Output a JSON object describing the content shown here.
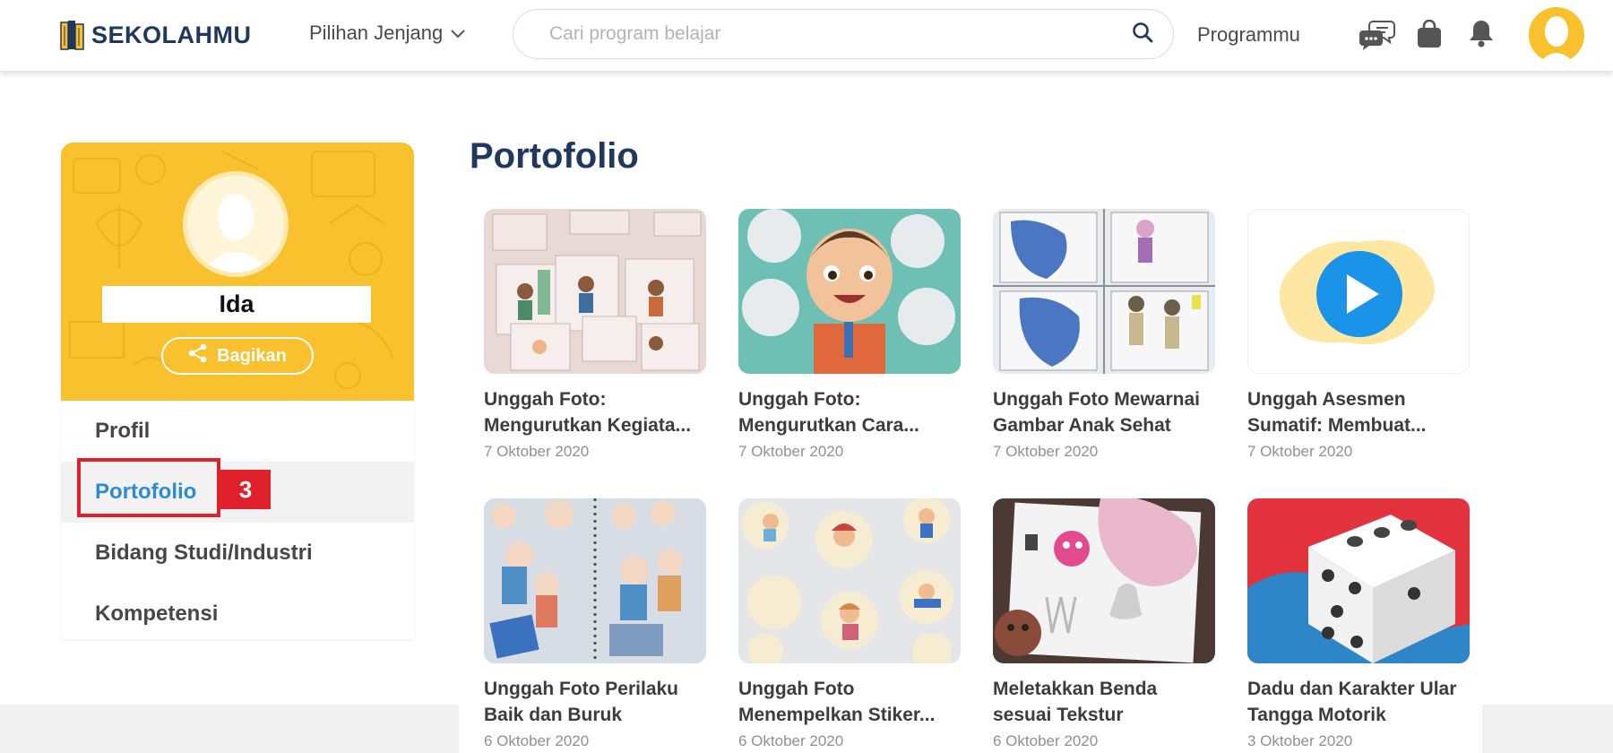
{
  "header": {
    "logo_text": "SEKOLAH",
    "logo_text_bold": "MU",
    "jenjang_label": "Pilihan Jenjang",
    "search_placeholder": "Cari program belajar",
    "programmu_label": "Programmu"
  },
  "profile": {
    "name": "Ida",
    "share_label": "Bagikan"
  },
  "menu": [
    {
      "label": "Profil",
      "active": false
    },
    {
      "label": "Portofolio",
      "active": true
    },
    {
      "label": "Bidang Studi/Industri",
      "active": false
    },
    {
      "label": "Kompetensi",
      "active": false
    }
  ],
  "annotation": {
    "step": "3"
  },
  "main": {
    "title": "Portofolio",
    "cards": [
      {
        "title": "Unggah Foto: Mengurutkan Kegiata...",
        "date": "7 Oktober 2020"
      },
      {
        "title": "Unggah Foto: Mengurutkan Cara...",
        "date": "7 Oktober 2020"
      },
      {
        "title": "Unggah Foto Mewarnai Gambar Anak Sehat",
        "date": "7 Oktober 2020"
      },
      {
        "title": "Unggah Asesmen Sumatif: Membuat...",
        "date": "7 Oktober 2020"
      },
      {
        "title": "Unggah Foto Perilaku Baik dan Buruk",
        "date": "6 Oktober 2020"
      },
      {
        "title": "Unggah Foto Menempelkan Stiker...",
        "date": "6 Oktober 2020"
      },
      {
        "title": "Meletakkan Benda sesuai Tekstur",
        "date": "6 Oktober 2020"
      },
      {
        "title": "Dadu dan Karakter Ular Tangga Motorik",
        "date": "3 Oktober 2020"
      }
    ]
  },
  "colors": {
    "brand_yellow": "#f9c12d",
    "brand_navy": "#20375e",
    "active_blue": "#2c8bd1",
    "annotation_red": "#e0212b"
  }
}
